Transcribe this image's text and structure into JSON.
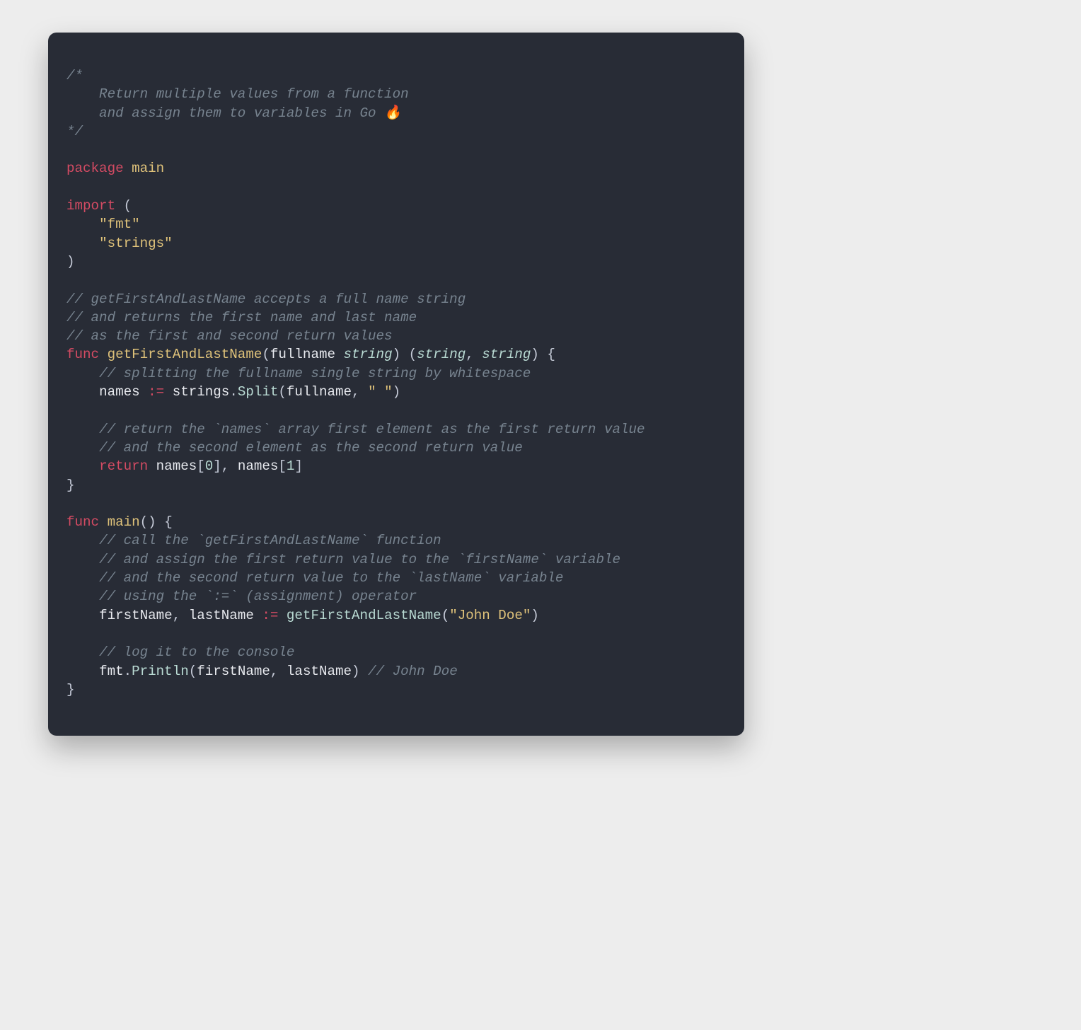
{
  "lines": [
    [
      {
        "cls": "tok-comment",
        "t": "/*"
      }
    ],
    [
      {
        "cls": "tok-comment",
        "t": "    Return multiple values from a function"
      }
    ],
    [
      {
        "cls": "tok-comment",
        "t": "    and assign them to variables in Go 🔥"
      }
    ],
    [
      {
        "cls": "tok-comment",
        "t": "*/"
      }
    ],
    [
      {
        "cls": "",
        "t": ""
      }
    ],
    [
      {
        "cls": "tok-keyword",
        "t": "package"
      },
      {
        "cls": "",
        "t": " "
      },
      {
        "cls": "tok-funcname",
        "t": "main"
      }
    ],
    [
      {
        "cls": "",
        "t": ""
      }
    ],
    [
      {
        "cls": "tok-keyword",
        "t": "import"
      },
      {
        "cls": "",
        "t": " "
      },
      {
        "cls": "tok-punct",
        "t": "("
      }
    ],
    [
      {
        "cls": "",
        "t": "    "
      },
      {
        "cls": "tok-string",
        "t": "\"fmt\""
      }
    ],
    [
      {
        "cls": "",
        "t": "    "
      },
      {
        "cls": "tok-string",
        "t": "\"strings\""
      }
    ],
    [
      {
        "cls": "tok-punct",
        "t": ")"
      }
    ],
    [
      {
        "cls": "",
        "t": ""
      }
    ],
    [
      {
        "cls": "tok-comment",
        "t": "// getFirstAndLastName accepts a full name string"
      }
    ],
    [
      {
        "cls": "tok-comment",
        "t": "// and returns the first name and last name"
      }
    ],
    [
      {
        "cls": "tok-comment",
        "t": "// as the first and second return values"
      }
    ],
    [
      {
        "cls": "tok-keyword",
        "t": "func"
      },
      {
        "cls": "",
        "t": " "
      },
      {
        "cls": "tok-funcname",
        "t": "getFirstAndLastName"
      },
      {
        "cls": "tok-punct",
        "t": "("
      },
      {
        "cls": "tok-ident",
        "t": "fullname"
      },
      {
        "cls": "",
        "t": " "
      },
      {
        "cls": "tok-type",
        "t": "string"
      },
      {
        "cls": "tok-punct",
        "t": ")"
      },
      {
        "cls": "",
        "t": " "
      },
      {
        "cls": "tok-punct",
        "t": "("
      },
      {
        "cls": "tok-type",
        "t": "string"
      },
      {
        "cls": "tok-punct",
        "t": ","
      },
      {
        "cls": "",
        "t": " "
      },
      {
        "cls": "tok-type",
        "t": "string"
      },
      {
        "cls": "tok-punct",
        "t": ")"
      },
      {
        "cls": "",
        "t": " "
      },
      {
        "cls": "tok-punct",
        "t": "{"
      }
    ],
    [
      {
        "cls": "",
        "t": "    "
      },
      {
        "cls": "tok-comment",
        "t": "// splitting the fullname single string by whitespace"
      }
    ],
    [
      {
        "cls": "",
        "t": "    "
      },
      {
        "cls": "tok-ident",
        "t": "names"
      },
      {
        "cls": "",
        "t": " "
      },
      {
        "cls": "tok-op",
        "t": ":="
      },
      {
        "cls": "",
        "t": " "
      },
      {
        "cls": "tok-ident",
        "t": "strings"
      },
      {
        "cls": "tok-punct",
        "t": "."
      },
      {
        "cls": "tok-call",
        "t": "Split"
      },
      {
        "cls": "tok-punct",
        "t": "("
      },
      {
        "cls": "tok-ident",
        "t": "fullname"
      },
      {
        "cls": "tok-punct",
        "t": ","
      },
      {
        "cls": "",
        "t": " "
      },
      {
        "cls": "tok-string",
        "t": "\" \""
      },
      {
        "cls": "tok-punct",
        "t": ")"
      }
    ],
    [
      {
        "cls": "",
        "t": ""
      }
    ],
    [
      {
        "cls": "",
        "t": "    "
      },
      {
        "cls": "tok-comment",
        "t": "// return the `names` array first element as the first return value"
      }
    ],
    [
      {
        "cls": "",
        "t": "    "
      },
      {
        "cls": "tok-comment",
        "t": "// and the second element as the second return value"
      }
    ],
    [
      {
        "cls": "",
        "t": "    "
      },
      {
        "cls": "tok-keyword",
        "t": "return"
      },
      {
        "cls": "",
        "t": " "
      },
      {
        "cls": "tok-ident",
        "t": "names"
      },
      {
        "cls": "tok-punct",
        "t": "["
      },
      {
        "cls": "tok-number",
        "t": "0"
      },
      {
        "cls": "tok-punct",
        "t": "]"
      },
      {
        "cls": "tok-punct",
        "t": ","
      },
      {
        "cls": "",
        "t": " "
      },
      {
        "cls": "tok-ident",
        "t": "names"
      },
      {
        "cls": "tok-punct",
        "t": "["
      },
      {
        "cls": "tok-number",
        "t": "1"
      },
      {
        "cls": "tok-punct",
        "t": "]"
      }
    ],
    [
      {
        "cls": "tok-punct",
        "t": "}"
      }
    ],
    [
      {
        "cls": "",
        "t": ""
      }
    ],
    [
      {
        "cls": "tok-keyword",
        "t": "func"
      },
      {
        "cls": "",
        "t": " "
      },
      {
        "cls": "tok-funcname",
        "t": "main"
      },
      {
        "cls": "tok-punct",
        "t": "()"
      },
      {
        "cls": "",
        "t": " "
      },
      {
        "cls": "tok-punct",
        "t": "{"
      }
    ],
    [
      {
        "cls": "",
        "t": "    "
      },
      {
        "cls": "tok-comment",
        "t": "// call the `getFirstAndLastName` function"
      }
    ],
    [
      {
        "cls": "",
        "t": "    "
      },
      {
        "cls": "tok-comment",
        "t": "// and assign the first return value to the `firstName` variable"
      }
    ],
    [
      {
        "cls": "",
        "t": "    "
      },
      {
        "cls": "tok-comment",
        "t": "// and the second return value to the `lastName` variable"
      }
    ],
    [
      {
        "cls": "",
        "t": "    "
      },
      {
        "cls": "tok-comment",
        "t": "// using the `:=` (assignment) operator"
      }
    ],
    [
      {
        "cls": "",
        "t": "    "
      },
      {
        "cls": "tok-ident",
        "t": "firstName"
      },
      {
        "cls": "tok-punct",
        "t": ","
      },
      {
        "cls": "",
        "t": " "
      },
      {
        "cls": "tok-ident",
        "t": "lastName"
      },
      {
        "cls": "",
        "t": " "
      },
      {
        "cls": "tok-op",
        "t": ":="
      },
      {
        "cls": "",
        "t": " "
      },
      {
        "cls": "tok-call",
        "t": "getFirstAndLastName"
      },
      {
        "cls": "tok-punct",
        "t": "("
      },
      {
        "cls": "tok-string",
        "t": "\"John Doe\""
      },
      {
        "cls": "tok-punct",
        "t": ")"
      }
    ],
    [
      {
        "cls": "",
        "t": ""
      }
    ],
    [
      {
        "cls": "",
        "t": "    "
      },
      {
        "cls": "tok-comment",
        "t": "// log it to the console"
      }
    ],
    [
      {
        "cls": "",
        "t": "    "
      },
      {
        "cls": "tok-ident",
        "t": "fmt"
      },
      {
        "cls": "tok-punct",
        "t": "."
      },
      {
        "cls": "tok-call",
        "t": "Println"
      },
      {
        "cls": "tok-punct",
        "t": "("
      },
      {
        "cls": "tok-ident",
        "t": "firstName"
      },
      {
        "cls": "tok-punct",
        "t": ","
      },
      {
        "cls": "",
        "t": " "
      },
      {
        "cls": "tok-ident",
        "t": "lastName"
      },
      {
        "cls": "tok-punct",
        "t": ")"
      },
      {
        "cls": "",
        "t": " "
      },
      {
        "cls": "tok-comment",
        "t": "// John Doe"
      }
    ],
    [
      {
        "cls": "tok-punct",
        "t": "}"
      }
    ]
  ]
}
